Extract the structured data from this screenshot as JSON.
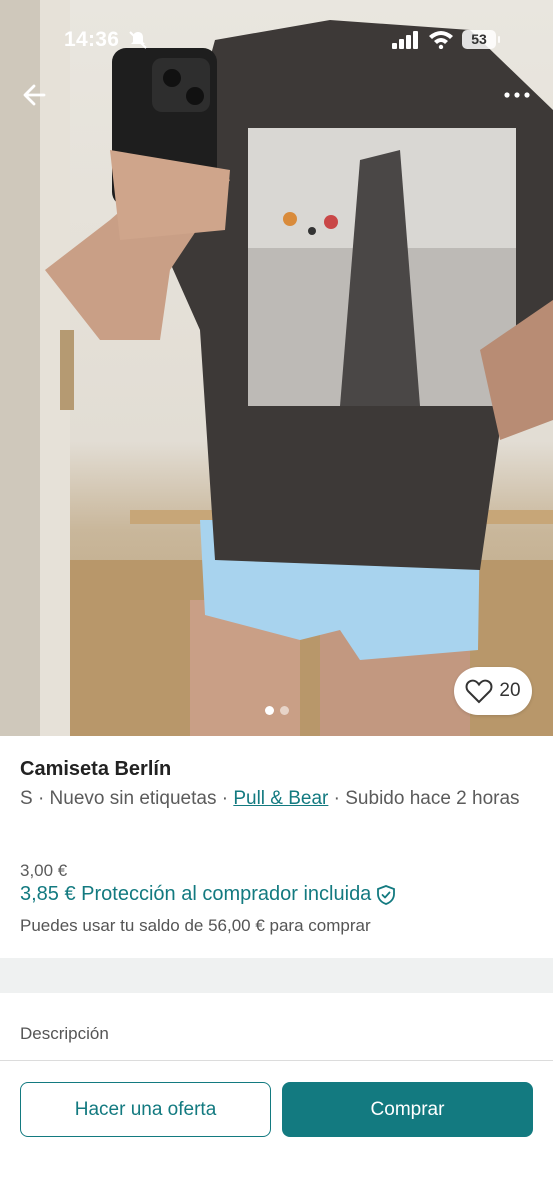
{
  "status_bar": {
    "time": "14:36",
    "battery": "53"
  },
  "gallery": {
    "image_count": 2,
    "active_index": 0
  },
  "favorites": {
    "count": "20"
  },
  "product": {
    "title": "Camiseta Berlín",
    "meta_prefix": "S · Nuevo sin etiquetas · ",
    "brand": "Pull & Bear",
    "meta_suffix": " · Subido hace 2 horas",
    "price": "3,00 €",
    "protected_price": "3,85 € Protección al comprador incluida",
    "balance_note": "Puedes usar tu saldo de 56,00 € para comprar"
  },
  "description": {
    "label": "Descripción"
  },
  "actions": {
    "offer_label": "Hacer una oferta",
    "buy_label": "Comprar"
  },
  "colors": {
    "accent": "#137a80",
    "band": "#eff1f1"
  },
  "icons": [
    "mute-icon",
    "signal-icon",
    "wifi-icon",
    "battery-icon",
    "back-arrow-icon",
    "more-icon",
    "heart-icon",
    "shield-check-icon"
  ]
}
